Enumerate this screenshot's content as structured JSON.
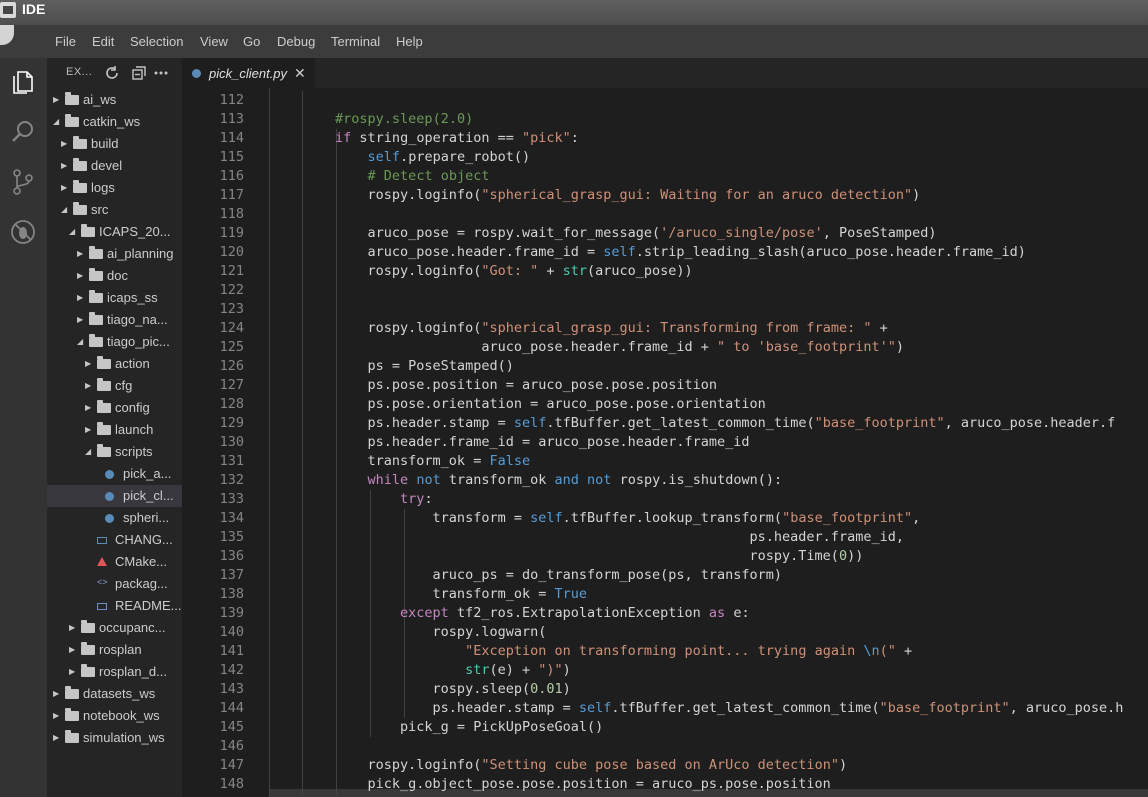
{
  "window": {
    "title": "IDE"
  },
  "menubar": {
    "items": [
      "File",
      "Edit",
      "Selection",
      "View",
      "Go",
      "Debug",
      "Terminal",
      "Help"
    ]
  },
  "activitybar": {
    "icons": [
      "files-icon",
      "search-icon",
      "source-control-icon",
      "debug-icon"
    ]
  },
  "sidebar": {
    "title": "EX...",
    "tree": [
      {
        "label": "ai_ws",
        "type": "folder",
        "expanded": false
      },
      {
        "label": "catkin_ws",
        "type": "folder",
        "expanded": true
      },
      {
        "label": "build",
        "type": "folder",
        "expanded": false
      },
      {
        "label": "devel",
        "type": "folder",
        "expanded": false
      },
      {
        "label": "logs",
        "type": "folder",
        "expanded": false
      },
      {
        "label": "src",
        "type": "folder",
        "expanded": true
      },
      {
        "label": "ICAPS_20...",
        "type": "folder",
        "expanded": true
      },
      {
        "label": "ai_planning",
        "type": "folder",
        "expanded": false
      },
      {
        "label": "doc",
        "type": "folder",
        "expanded": false
      },
      {
        "label": "icaps_ss",
        "type": "folder",
        "expanded": false
      },
      {
        "label": "tiago_na...",
        "type": "folder",
        "expanded": false
      },
      {
        "label": "tiago_pic...",
        "type": "folder",
        "expanded": true
      },
      {
        "label": "action",
        "type": "folder",
        "expanded": false
      },
      {
        "label": "cfg",
        "type": "folder",
        "expanded": false
      },
      {
        "label": "config",
        "type": "folder",
        "expanded": false
      },
      {
        "label": "launch",
        "type": "folder",
        "expanded": false
      },
      {
        "label": "scripts",
        "type": "folder",
        "expanded": true
      },
      {
        "label": "pick_a...",
        "type": "python"
      },
      {
        "label": "pick_cl...",
        "type": "python",
        "selected": true
      },
      {
        "label": "spheri...",
        "type": "python"
      },
      {
        "label": "CHANG...",
        "type": "text"
      },
      {
        "label": "CMake...",
        "type": "cmake"
      },
      {
        "label": "packag...",
        "type": "xml"
      },
      {
        "label": "README...",
        "type": "markdown"
      },
      {
        "label": "occupanc...",
        "type": "folder",
        "expanded": false
      },
      {
        "label": "rosplan",
        "type": "folder",
        "expanded": false
      },
      {
        "label": "rosplan_d...",
        "type": "folder",
        "expanded": false
      },
      {
        "label": "datasets_ws",
        "type": "folder",
        "expanded": false
      },
      {
        "label": "notebook_ws",
        "type": "folder",
        "expanded": false
      },
      {
        "label": "simulation_ws",
        "type": "folder",
        "expanded": false
      }
    ]
  },
  "editor": {
    "tab": {
      "label": "pick_client.py",
      "close": "✕"
    },
    "lines": [
      {
        "n": "112",
        "tokens": []
      },
      {
        "n": "113",
        "tokens": [
          [
            "        ",
            ""
          ],
          [
            "#rospy.sleep(2.0)",
            "com"
          ]
        ]
      },
      {
        "n": "114",
        "tokens": [
          [
            "        ",
            ""
          ],
          [
            "if",
            "kw"
          ],
          [
            " string_operation == ",
            ""
          ],
          [
            "\"pick\"",
            "str"
          ],
          [
            ":",
            ""
          ]
        ]
      },
      {
        "n": "115",
        "tokens": [
          [
            "            ",
            ""
          ],
          [
            "self",
            "blue"
          ],
          [
            ".prepare_robot()",
            ""
          ]
        ]
      },
      {
        "n": "116",
        "tokens": [
          [
            "            ",
            ""
          ],
          [
            "# Detect object",
            "com"
          ]
        ]
      },
      {
        "n": "117",
        "tokens": [
          [
            "            rospy.loginfo(",
            ""
          ],
          [
            "\"spherical_grasp_gui: Waiting for an aruco detection\"",
            "str"
          ],
          [
            ")",
            ""
          ]
        ]
      },
      {
        "n": "118",
        "tokens": []
      },
      {
        "n": "119",
        "tokens": [
          [
            "            aruco_pose = rospy.wait_for_message(",
            ""
          ],
          [
            "'/aruco_single/pose'",
            "str"
          ],
          [
            ", PoseStamped)",
            ""
          ]
        ]
      },
      {
        "n": "120",
        "tokens": [
          [
            "            aruco_pose.header.frame_id = ",
            ""
          ],
          [
            "self",
            "blue"
          ],
          [
            ".strip_leading_slash(aruco_pose.header.frame_id)",
            ""
          ]
        ]
      },
      {
        "n": "121",
        "tokens": [
          [
            "            rospy.loginfo(",
            ""
          ],
          [
            "\"Got: \"",
            "str"
          ],
          [
            " + ",
            ""
          ],
          [
            "str",
            "fn"
          ],
          [
            "(aruco_pose))",
            ""
          ]
        ]
      },
      {
        "n": "122",
        "tokens": []
      },
      {
        "n": "123",
        "tokens": []
      },
      {
        "n": "124",
        "tokens": [
          [
            "            rospy.loginfo(",
            ""
          ],
          [
            "\"spherical_grasp_gui: Transforming from frame: \"",
            "str"
          ],
          [
            " +",
            ""
          ]
        ]
      },
      {
        "n": "125",
        "tokens": [
          [
            "                          aruco_pose.header.frame_id + ",
            ""
          ],
          [
            "\" to 'base_footprint'\"",
            "str"
          ],
          [
            ")",
            ""
          ]
        ]
      },
      {
        "n": "126",
        "tokens": [
          [
            "            ps = PoseStamped()",
            ""
          ]
        ]
      },
      {
        "n": "127",
        "tokens": [
          [
            "            ps.pose.position = aruco_pose.pose.position",
            ""
          ]
        ]
      },
      {
        "n": "128",
        "tokens": [
          [
            "            ps.pose.orientation = aruco_pose.pose.orientation",
            ""
          ]
        ]
      },
      {
        "n": "129",
        "tokens": [
          [
            "            ps.header.stamp = ",
            ""
          ],
          [
            "self",
            "blue"
          ],
          [
            ".tfBuffer.get_latest_common_time(",
            ""
          ],
          [
            "\"base_footprint\"",
            "str"
          ],
          [
            ", aruco_pose.header.f",
            ""
          ]
        ]
      },
      {
        "n": "130",
        "tokens": [
          [
            "            ps.header.frame_id = aruco_pose.header.frame_id",
            ""
          ]
        ]
      },
      {
        "n": "131",
        "tokens": [
          [
            "            transform_ok = ",
            ""
          ],
          [
            "False",
            "blue"
          ]
        ]
      },
      {
        "n": "132",
        "tokens": [
          [
            "            ",
            ""
          ],
          [
            "while",
            "kw"
          ],
          [
            " ",
            ""
          ],
          [
            "not",
            "blue"
          ],
          [
            " transform_ok ",
            ""
          ],
          [
            "and",
            "blue"
          ],
          [
            " ",
            ""
          ],
          [
            "not",
            "blue"
          ],
          [
            " rospy.is_shutdown():",
            ""
          ]
        ]
      },
      {
        "n": "133",
        "tokens": [
          [
            "                ",
            ""
          ],
          [
            "try",
            "kw"
          ],
          [
            ":",
            ""
          ]
        ]
      },
      {
        "n": "134",
        "tokens": [
          [
            "                    transform = ",
            ""
          ],
          [
            "self",
            "blue"
          ],
          [
            ".tfBuffer.lookup_transform(",
            ""
          ],
          [
            "\"base_footprint\"",
            "str"
          ],
          [
            ",",
            ""
          ]
        ]
      },
      {
        "n": "135",
        "tokens": [
          [
            "                                                           ps.header.frame_id,",
            ""
          ]
        ]
      },
      {
        "n": "136",
        "tokens": [
          [
            "                                                           rospy.Time(",
            ""
          ],
          [
            "0",
            "num"
          ],
          [
            "))",
            ""
          ]
        ]
      },
      {
        "n": "137",
        "tokens": [
          [
            "                    aruco_ps = do_transform_pose(ps, transform)",
            ""
          ]
        ]
      },
      {
        "n": "138",
        "tokens": [
          [
            "                    transform_ok = ",
            ""
          ],
          [
            "True",
            "blue"
          ]
        ]
      },
      {
        "n": "139",
        "tokens": [
          [
            "                ",
            ""
          ],
          [
            "except",
            "kw"
          ],
          [
            " tf2_ros.ExtrapolationException ",
            ""
          ],
          [
            "as",
            "kw"
          ],
          [
            " e:",
            ""
          ]
        ]
      },
      {
        "n": "140",
        "tokens": [
          [
            "                    rospy.logwarn(",
            ""
          ]
        ]
      },
      {
        "n": "141",
        "tokens": [
          [
            "                        ",
            ""
          ],
          [
            "\"Exception on transforming point... trying again ",
            "str"
          ],
          [
            "\\n",
            "blue"
          ],
          [
            "(\"",
            "str"
          ],
          [
            " +",
            ""
          ]
        ]
      },
      {
        "n": "142",
        "tokens": [
          [
            "                        ",
            ""
          ],
          [
            "str",
            "fn"
          ],
          [
            "(e) + ",
            ""
          ],
          [
            "\")\"",
            "str"
          ],
          [
            ")",
            ""
          ]
        ]
      },
      {
        "n": "143",
        "tokens": [
          [
            "                    rospy.sleep(",
            ""
          ],
          [
            "0.01",
            "num"
          ],
          [
            ")",
            ""
          ]
        ]
      },
      {
        "n": "144",
        "tokens": [
          [
            "                    ps.header.stamp = ",
            ""
          ],
          [
            "self",
            "blue"
          ],
          [
            ".tfBuffer.get_latest_common_time(",
            ""
          ],
          [
            "\"base_footprint\"",
            "str"
          ],
          [
            ", aruco_pose.h",
            ""
          ]
        ]
      },
      {
        "n": "145",
        "tokens": [
          [
            "                pick_g = PickUpPoseGoal()",
            ""
          ]
        ]
      },
      {
        "n": "146",
        "tokens": []
      },
      {
        "n": "147",
        "tokens": [
          [
            "            rospy.loginfo(",
            ""
          ],
          [
            "\"Setting cube pose based on ArUco detection\"",
            "str"
          ],
          [
            ")",
            ""
          ]
        ]
      },
      {
        "n": "148",
        "tokens": [
          [
            "            pick_g.object_pose.pose.position = aruco_ps.pose.position",
            ""
          ]
        ]
      }
    ]
  }
}
